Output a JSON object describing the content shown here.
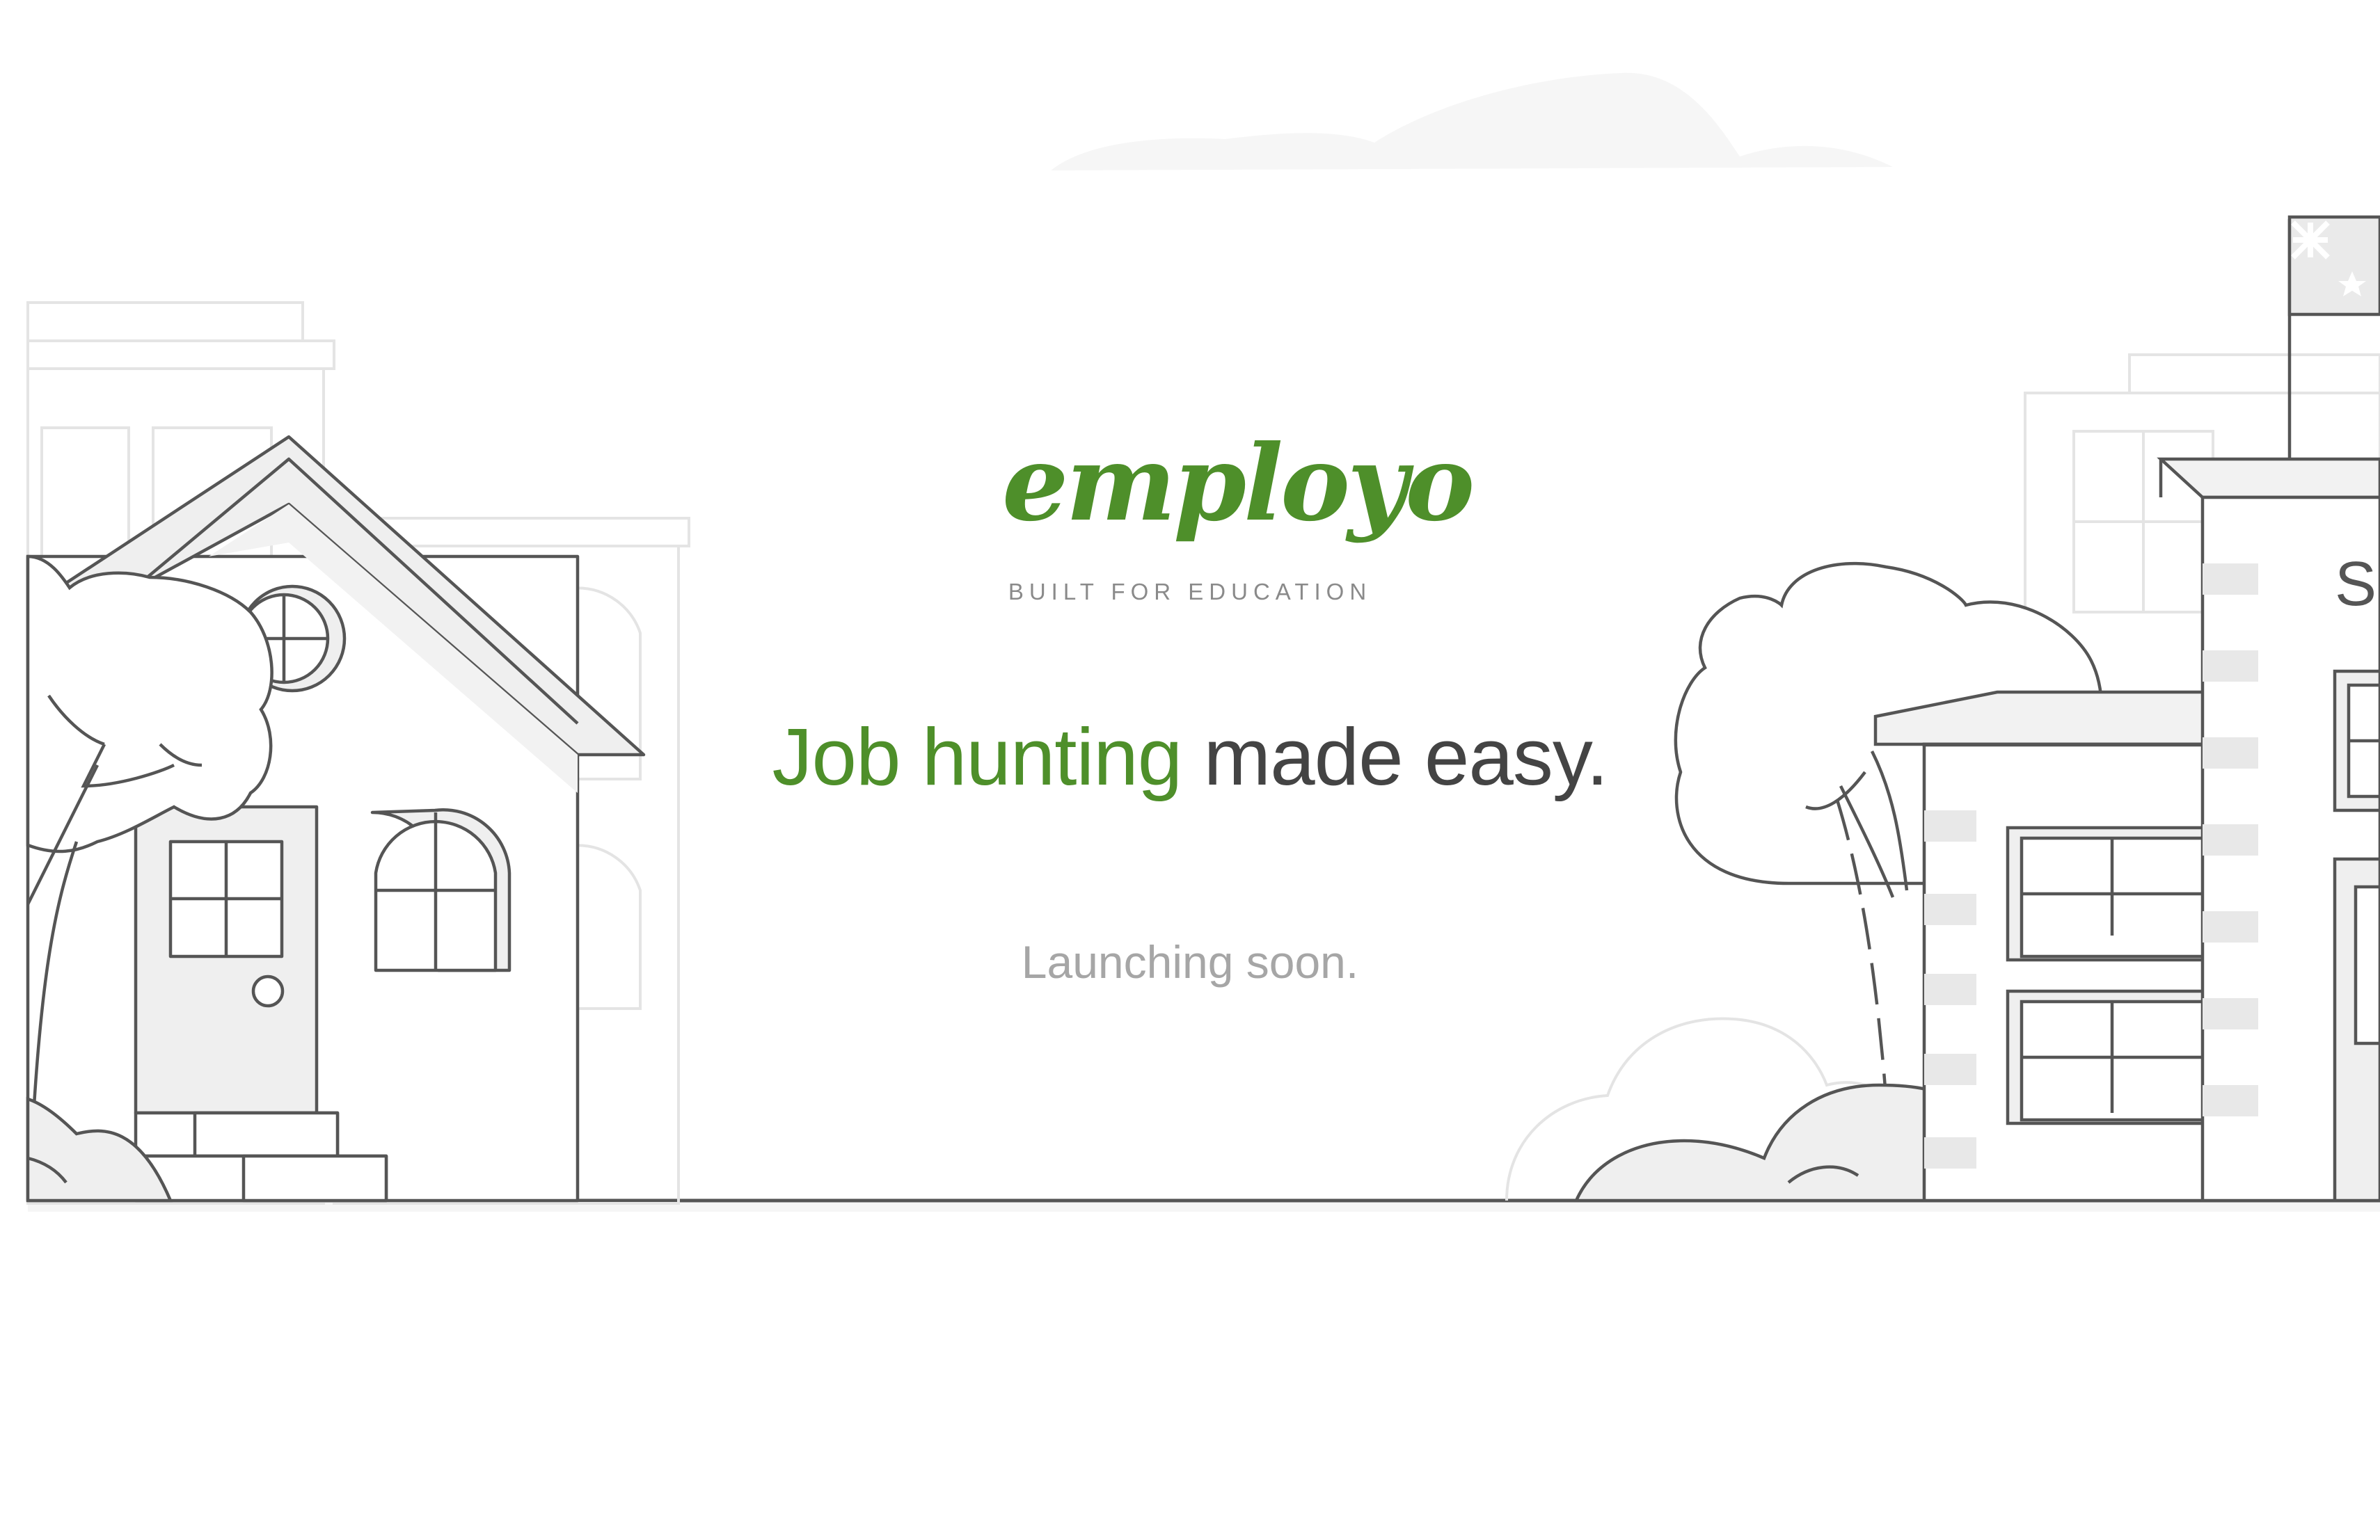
{
  "brand": {
    "logo_text": "employo",
    "tagline": "BUILT FOR EDUCATION"
  },
  "hero": {
    "headline_accent": "Job hunting",
    "headline_rest": " made easy.",
    "subline": "Launching soon."
  },
  "illustration": {
    "school_sign_fragment": "SC"
  },
  "colors": {
    "brand_green": "#4e8f2a",
    "headline_dark": "#444444",
    "subline_gray": "#a6a6a6",
    "line_gray": "#555555",
    "fill_light": "#efefef",
    "fill_faint": "#f6f6f6"
  }
}
